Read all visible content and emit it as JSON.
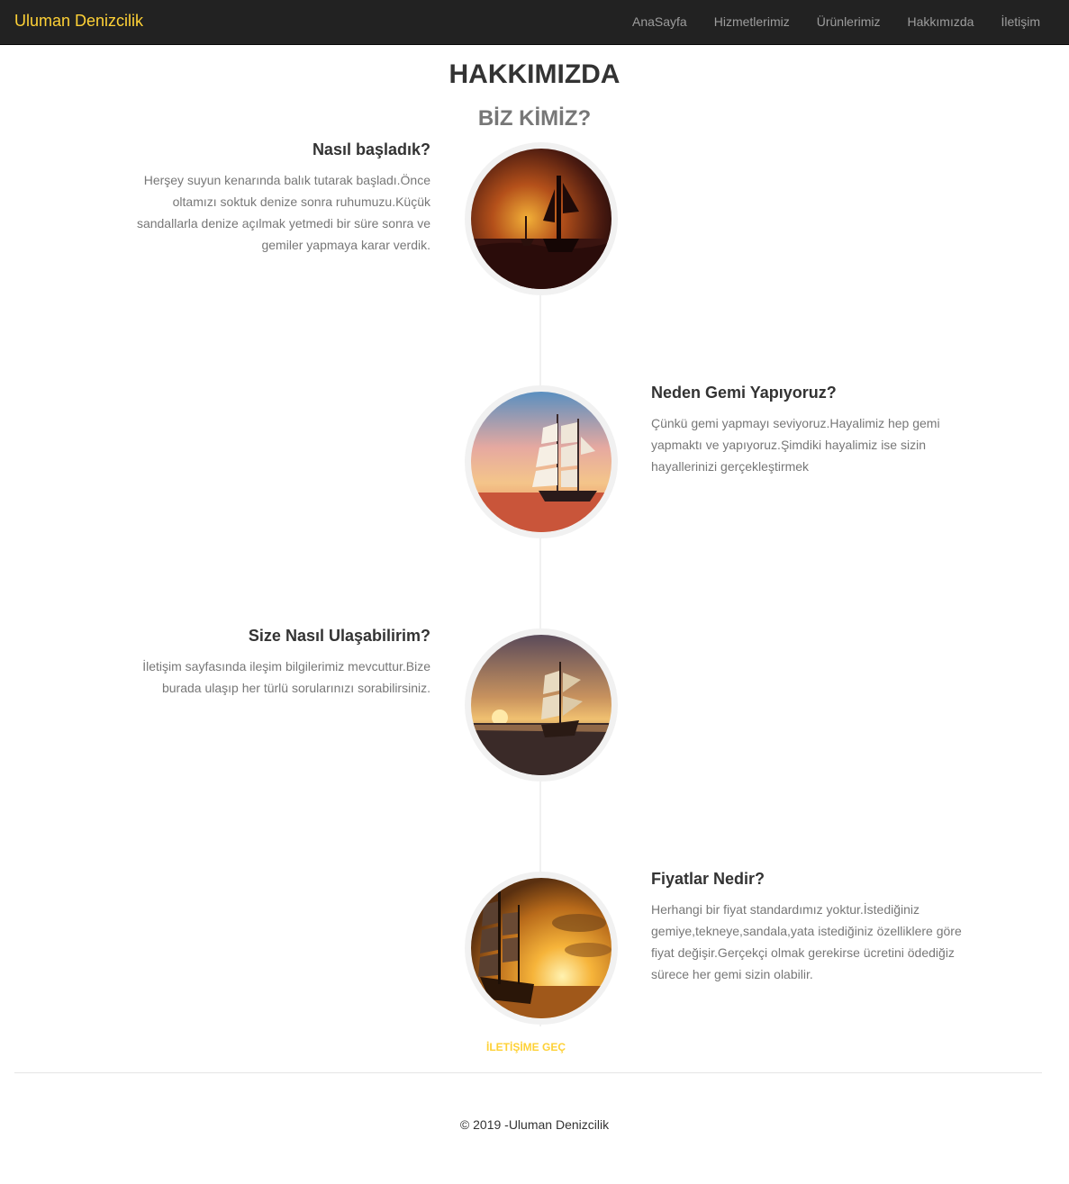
{
  "navbar": {
    "brand": "Uluman Denizcilik",
    "links": [
      "AnaSayfa",
      "Hizmetlerimiz",
      "Ürünlerimiz",
      "Hakkımızda",
      "İletişim"
    ]
  },
  "page": {
    "title": "HAKKIMIZDA",
    "subtitle": "BİZ KİMİZ?"
  },
  "timeline": [
    {
      "heading": "Nasıl başladık?",
      "body": "Herşey suyun kenarında balık tutarak başladı.Önce oltamızı soktuk denize sonra ruhumuzu.Küçük sandallarla denize açılmak yetmedi bir süre sonra ve gemiler yapmaya karar verdik."
    },
    {
      "heading": "Neden Gemi Yapıyoruz?",
      "body": "Çünkü gemi yapmayı seviyoruz.Hayalimiz hep gemi yapmaktı ve yapıyoruz.Şimdiki hayalimiz ise sizin hayallerinizi gerçekleştirmek"
    },
    {
      "heading": "Size Nasıl Ulaşabilirim?",
      "body": "İletişim sayfasında ileşim bilgilerimiz mevcuttur.Bize burada ulaşıp her türlü sorularınızı sorabilirsiniz."
    },
    {
      "heading": "Fiyatlar Nedir?",
      "body": "Herhangi bir fiyat standardımız yoktur.İstediğiniz gemiye,tekneye,sandala,yata istediğiniz özelliklere göre fiyat değişir.Gerçekçi olmak gerekirse ücretini ödediğiz sürece her gemi sizin olabilir."
    }
  ],
  "cta_label": "İLETİŞİME GEÇ",
  "footer": "© 2019 -Uluman Denizcilik",
  "colors": {
    "navbar_bg": "#222222",
    "brand": "#fed136",
    "nav_link": "#9d9d9d",
    "accent": "#fed136"
  }
}
